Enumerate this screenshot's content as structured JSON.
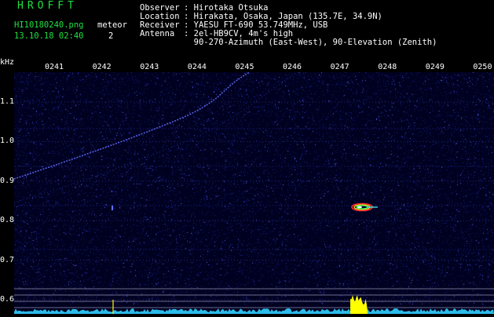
{
  "header": {
    "app_title": "HROFFT",
    "file_name": "HI10180240.png",
    "meteor_label": "meteor",
    "timestamp": "13.10.18 02:40",
    "meteor_count": "2"
  },
  "info": [
    {
      "label": "Observer",
      "value": "Hirotaka Otsuka"
    },
    {
      "label": "Location",
      "value": "Hirakata, Osaka, Japan (135.7E, 34.9N)"
    },
    {
      "label": "Receiver",
      "value": "YAESU FT-690 53.749MHz, USB"
    },
    {
      "label": "Antenna",
      "value": "2el-HB9CV, 4m's high"
    },
    {
      "label": "",
      "value": "90-270-Azimuth (East-West), 90-Elevation (Zenith)"
    }
  ],
  "spectrogram": {
    "unit_label": "kHz",
    "time_ticks": [
      "0241",
      "0242",
      "0243",
      "0244",
      "0245",
      "0246",
      "0247",
      "0248",
      "0249",
      "0250"
    ],
    "freq_ticks": [
      "1.1",
      "1.0",
      "0.9",
      "0.8",
      "0.7",
      "0.6"
    ],
    "colors": {
      "background": "#000020",
      "noise": "#2830c0",
      "trace": "#6070ff",
      "text_green": "#20e040",
      "text_white": "#ffffff",
      "floor_line": "#30d0ff",
      "peak": "#ffff00"
    }
  }
}
